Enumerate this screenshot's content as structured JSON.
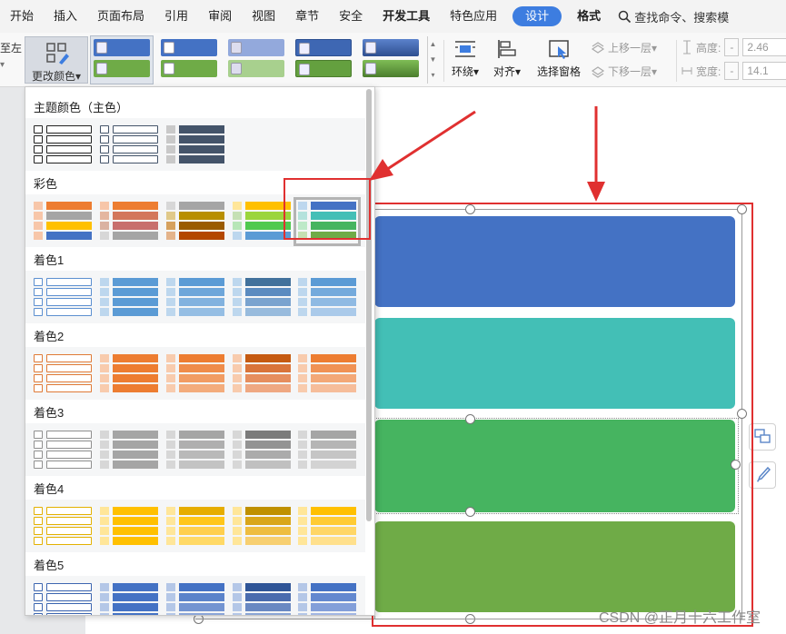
{
  "menubar": {
    "items": [
      "开始",
      "插入",
      "页面布局",
      "引用",
      "审阅",
      "视图",
      "章节",
      "安全",
      "开发工具",
      "特色应用",
      "设计",
      "格式"
    ],
    "active_index": 10,
    "search_text": "查找命令、搜索模"
  },
  "ribbon": {
    "cut_text": "至左",
    "change_color_label": "更改颜色",
    "wrap_label": "环绕",
    "align_label": "对齐",
    "selection_pane_label": "选择窗格",
    "bring_forward_label": "上移一层",
    "send_backward_label": "下移一层",
    "height_label": "高度:",
    "height_value": "2.46",
    "width_label": "宽度:",
    "width_value": "14.1"
  },
  "dropdown": {
    "sections": [
      {
        "title": "主题颜色（主色）"
      },
      {
        "title": "彩色"
      },
      {
        "title": "着色1"
      },
      {
        "title": "着色2"
      },
      {
        "title": "着色3"
      },
      {
        "title": "着色4"
      },
      {
        "title": "着色5"
      }
    ]
  },
  "colors": {
    "accent": "#3d7de0",
    "block_blue": "#4472c4",
    "block_teal": "#43bfb6",
    "block_green": "#46b460",
    "block_olive": "#6fab47",
    "highlight_red": "#e03030"
  },
  "watermark": "CSDN @正月十六工作室"
}
